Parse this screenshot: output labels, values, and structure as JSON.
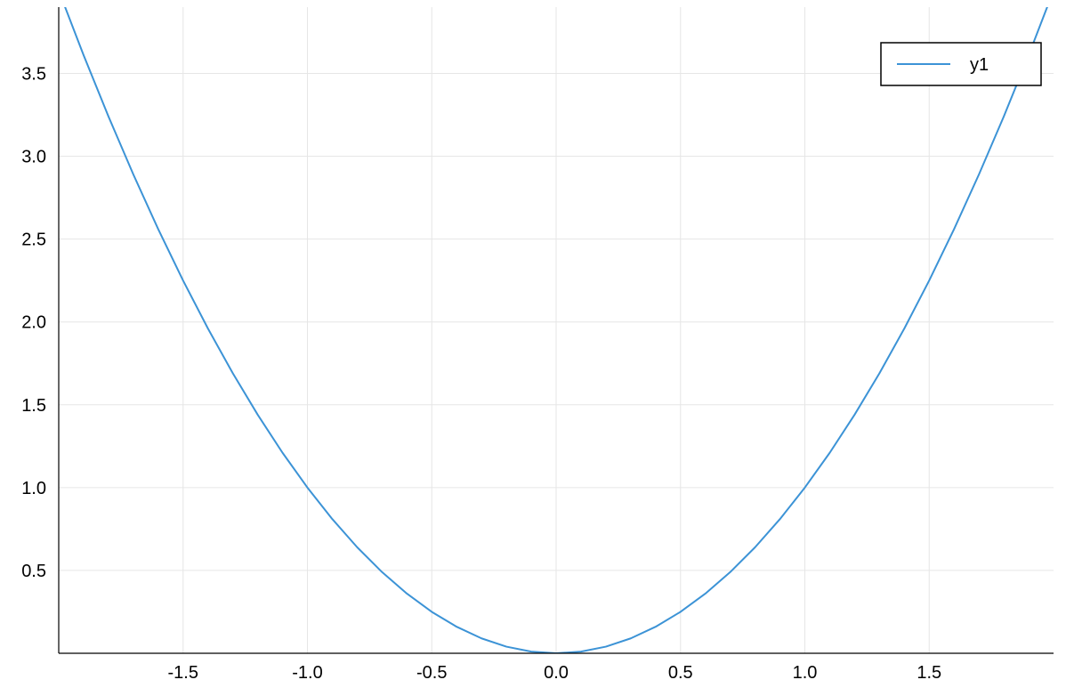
{
  "chart_data": {
    "type": "line",
    "title": "",
    "xlabel": "",
    "ylabel": "",
    "xlim": [
      -2.0,
      2.0
    ],
    "ylim": [
      0.0,
      3.9
    ],
    "x_ticks": [
      -1.5,
      -1.0,
      -0.5,
      0.0,
      0.5,
      1.0,
      1.5
    ],
    "y_ticks": [
      0.5,
      1.0,
      1.5,
      2.0,
      2.5,
      3.0,
      3.5
    ],
    "x_tick_labels": [
      "-1.5",
      "-1.0",
      "-0.5",
      "0.0",
      "0.5",
      "1.0",
      "1.5"
    ],
    "y_tick_labels": [
      "0.5",
      "1.0",
      "1.5",
      "2.0",
      "2.5",
      "3.0",
      "3.5"
    ],
    "grid": true,
    "legend": {
      "position": "top-right",
      "entries": [
        "y1"
      ]
    },
    "series": [
      {
        "name": "y1",
        "color": "#3c93d6",
        "x": [
          -2.0,
          -1.9,
          -1.8,
          -1.7,
          -1.6,
          -1.5,
          -1.4,
          -1.3,
          -1.2,
          -1.1,
          -1.0,
          -0.9,
          -0.8,
          -0.7,
          -0.6,
          -0.5,
          -0.4,
          -0.3,
          -0.2,
          -0.1,
          0.0,
          0.1,
          0.2,
          0.3,
          0.4,
          0.5,
          0.6,
          0.7,
          0.8,
          0.9,
          1.0,
          1.1,
          1.2,
          1.3,
          1.4,
          1.5,
          1.6,
          1.7,
          1.8,
          1.9,
          2.0
        ],
        "y": [
          4.0,
          3.61,
          3.24,
          2.89,
          2.56,
          2.25,
          1.96,
          1.69,
          1.44,
          1.21,
          1.0,
          0.81,
          0.64,
          0.49,
          0.36,
          0.25,
          0.16,
          0.09,
          0.04,
          0.01,
          0.0,
          0.01,
          0.04,
          0.09,
          0.16,
          0.25,
          0.36,
          0.49,
          0.64,
          0.81,
          1.0,
          1.21,
          1.44,
          1.69,
          1.96,
          2.25,
          2.56,
          2.89,
          3.24,
          3.61,
          4.0
        ]
      }
    ]
  }
}
